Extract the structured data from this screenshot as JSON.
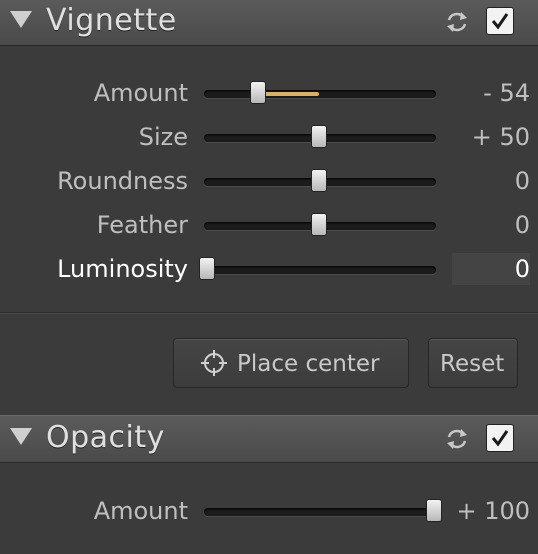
{
  "vignette": {
    "title": "Vignette",
    "enabled": true,
    "sliders": [
      {
        "label": "Amount",
        "value": "- 54",
        "position": 0.23,
        "fill_from": 0.23,
        "fill_to": 0.5,
        "active": false
      },
      {
        "label": "Size",
        "value": "+ 50",
        "position": 0.5,
        "active": false
      },
      {
        "label": "Roundness",
        "value": "0",
        "position": 0.5,
        "active": false
      },
      {
        "label": "Feather",
        "value": "0",
        "position": 0.5,
        "active": false
      },
      {
        "label": "Luminosity",
        "value": "0",
        "position": 0.0,
        "active": true
      }
    ],
    "place_center_label": "Place center",
    "reset_label": "Reset"
  },
  "opacity": {
    "title": "Opacity",
    "enabled": true,
    "sliders": [
      {
        "label": "Amount",
        "value": "+ 100",
        "position": 1.0,
        "active": false
      }
    ]
  },
  "colors": {
    "fill": "#d7b16a",
    "header": "#505050",
    "background": "#3b3b3b"
  },
  "icons": [
    "collapse-triangle-icon",
    "sync-icon",
    "checkbox-check-icon",
    "crosshair-icon"
  ]
}
